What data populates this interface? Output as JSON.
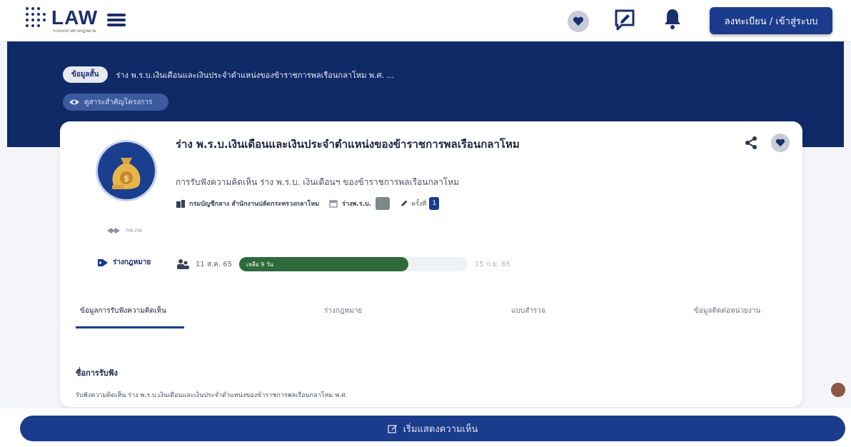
{
  "header": {
    "logo_text": "LAW",
    "logo_subtitle": "ระบบกลางทางกฎหมาย",
    "login_label": "ลงทะเบียน / เข้าสู่ระบบ"
  },
  "hero": {
    "breadcrumb_pill": "ข้อมูลสั้น",
    "breadcrumb_text": "ร่าง พ.ร.บ.เงินเดือนและเงินประจำตำแหน่งของข้าราชการพลเรือนกลาโหม พ.ศ. ...",
    "stats_label": "ดูสาระสำคัญโครงการ"
  },
  "project": {
    "title": "ร่าง พ.ร.บ.เงินเดือนและเงินประจำตำแหน่งของข้าราชการพลเรือนกลาโหม",
    "subtitle": "การรับฟังความคิดเห็น ร่าง พ.ร.บ. เงินเดือนฯ ของข้าราชการพลเรือนกลาโหม",
    "agency": "กรมบัญชีกลาง สำนักงานปลัดกระทรวงกลาโหม",
    "ministry_mark": "กห.กห",
    "type_label": "ร่างพ.ร.บ.",
    "round_label": "ครั้งที่",
    "round_value": "1",
    "tag": "ร่างกฎหมาย",
    "period_start": "11 ส.ค. 65",
    "period_end": "15 ก.ย. 65",
    "remaining_label": "เหลือ 9 วัน",
    "progress_fraction": 0.74
  },
  "tabs": [
    {
      "label": "ข้อมูลการรับฟังความคิดเห็น",
      "active": true
    },
    {
      "label": "ร่างกฎหมาย",
      "active": false
    },
    {
      "label": "แบบสำรวจ",
      "active": false
    },
    {
      "label": "ข้อมูลติดต่อหน่วยงาน",
      "active": false
    }
  ],
  "section": {
    "heading": "ชื่อการรับฟัง",
    "body": "รับฟังความคิดเห็น ร่าง พ.ร.บ.เงินเดือนและเงินประจำตำแหน่งของข้าราชการพลเรือนกลาโหม พ.ศ."
  },
  "cta": {
    "label": "เริ่มแสดงความเห็น"
  },
  "icons": {
    "menu": "hamburger-icon",
    "favorite": "heart-icon",
    "feedback": "chat-edit-icon",
    "notifications": "bell-icon",
    "share": "share-icon",
    "views": "eye-icon",
    "agency": "building-icon",
    "calendar": "calendar-icon",
    "edit": "pencil-icon",
    "tag": "tag-icon",
    "people": "people-icon"
  },
  "colors": {
    "primary": "#1b3c8c",
    "hero_bg": "#0f2a66",
    "progress": "#2e6a3a"
  }
}
